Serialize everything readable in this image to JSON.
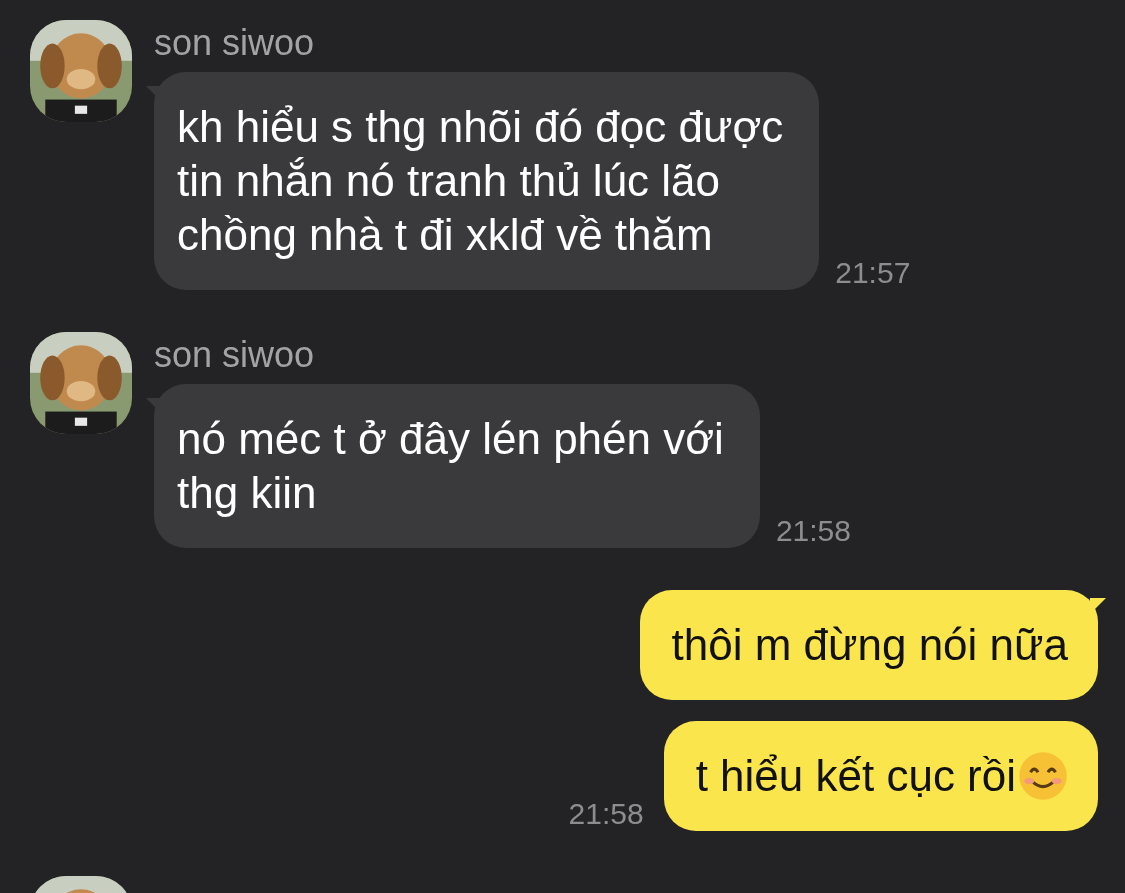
{
  "messages": [
    {
      "kind": "incoming",
      "sender": "son siwoo",
      "text": "kh hiểu s thg nhõi đó đọc được\ntin nhắn nó tranh thủ lúc lão\nchồng nhà t đi xklđ về thăm",
      "time": "21:57"
    },
    {
      "kind": "incoming",
      "sender": "son siwoo",
      "text": "nó méc t ở đây lén phén với\nthg kiin",
      "time": "21:58"
    },
    {
      "kind": "outgoing",
      "bubbles": [
        {
          "text": "thôi m đừng nói nữa"
        },
        {
          "text": "t hiểu kết cục rồi",
          "emoji": true
        }
      ],
      "time": "21:58"
    },
    {
      "kind": "avatar-only"
    }
  ]
}
